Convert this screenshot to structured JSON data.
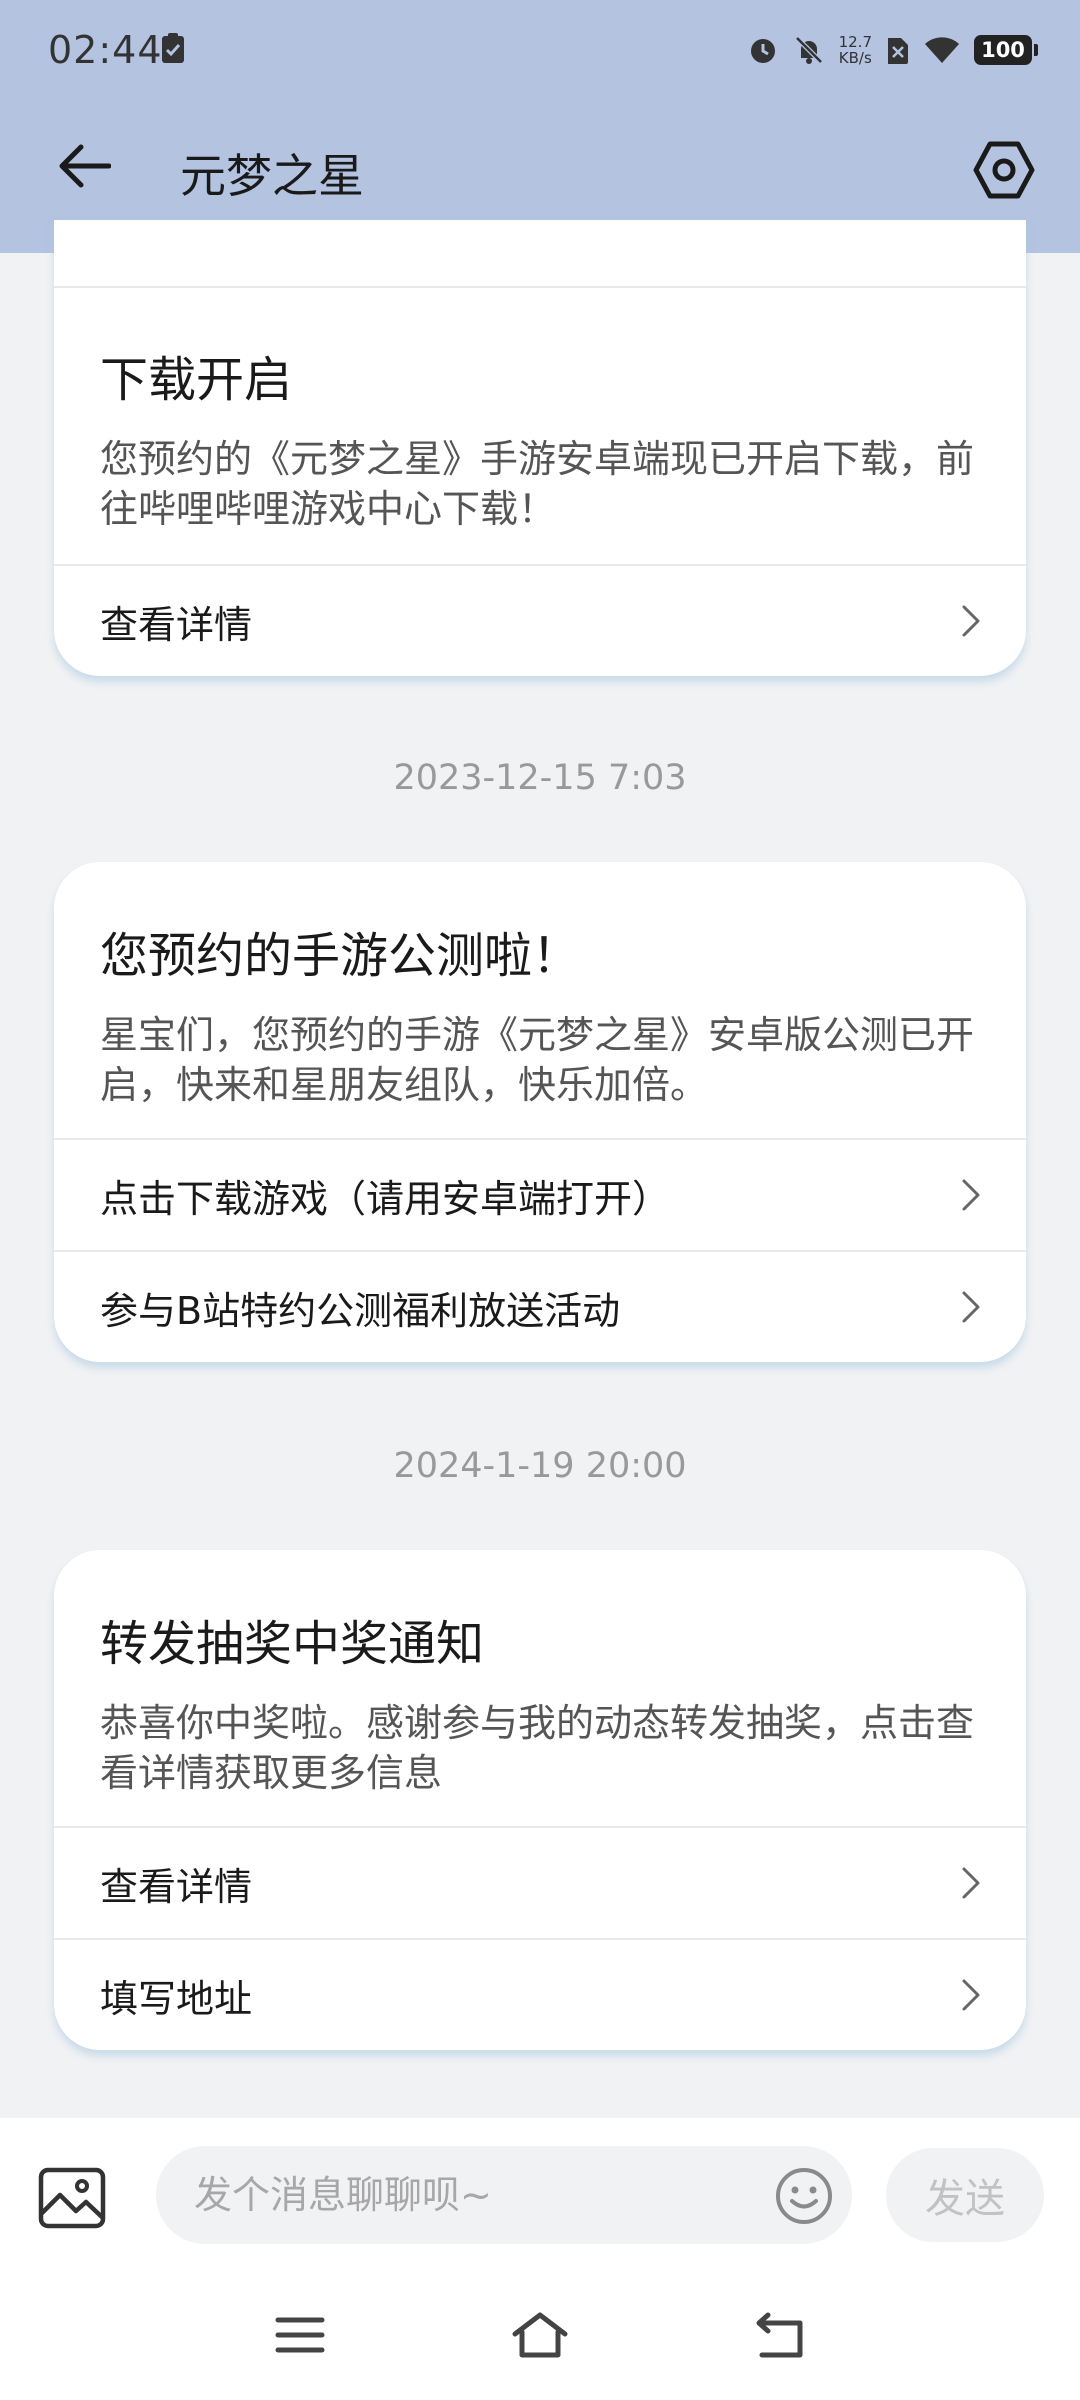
{
  "status_bar": {
    "time": "02:44",
    "net_speed_value": "12.7",
    "net_speed_unit": "KB/s",
    "battery": "100"
  },
  "header": {
    "title": "元梦之星"
  },
  "cards": [
    {
      "title": "下载开启",
      "text": "您预约的《元梦之星》手游安卓端现已开启下载，前往哔哩哔哩游戏中心下载！",
      "links": [
        "查看详情"
      ]
    },
    {
      "title": "您预约的手游公测啦！",
      "text": "星宝们，您预约的手游《元梦之星》安卓版公测已开启，快来和星朋友组队，快乐加倍。",
      "links": [
        "点击下载游戏（请用安卓端打开）",
        "参与B站特约公测福利放送活动"
      ]
    },
    {
      "title": "转发抽奖中奖通知",
      "text": "恭喜你中奖啦。感谢参与我的动态转发抽奖，点击查看详情获取更多信息",
      "links": [
        "查看详情",
        "填写地址"
      ]
    }
  ],
  "timestamps": [
    "2023-12-15 7:03",
    "2024-1-19 20:00"
  ],
  "input_bar": {
    "placeholder": "发个消息聊聊呗~",
    "send_label": "发送"
  },
  "icons": {
    "back": "arrow-left-icon",
    "settings": "hexagon-gear-icon",
    "image": "image-icon",
    "emoji": "smiley-icon",
    "chevron": "chevron-right-icon"
  },
  "colors": {
    "header_bg": "#b3c3e0",
    "page_bg": "#f1f2f4",
    "card_bg": "#ffffff"
  }
}
